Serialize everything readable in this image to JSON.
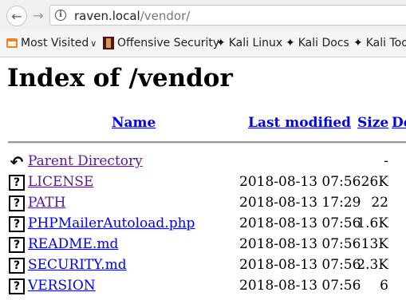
{
  "browser": {
    "url_host": "raven.local",
    "url_path": "/vendor/",
    "bookmarks": [
      {
        "label": "Most Visited",
        "icon": "folder-icon",
        "has_dropdown": true
      },
      {
        "label": "Offensive Security",
        "icon": "offsec-icon"
      },
      {
        "label": "Kali Linux",
        "icon": "kali-dragon-icon"
      },
      {
        "label": "Kali Docs",
        "icon": "kali-dragon-icon"
      },
      {
        "label": "Kali Too",
        "icon": "kali-dragon-icon"
      }
    ]
  },
  "page": {
    "title": "Index of /vendor",
    "columns": {
      "name": "Name",
      "modified": "Last modified",
      "size": "Size",
      "desc": "De"
    },
    "rows": [
      {
        "name": "Parent Directory",
        "modified": "",
        "size": "-",
        "icon": "back-icon"
      },
      {
        "name": "LICENSE",
        "modified": "2018-08-13 07:56",
        "size": "26K",
        "icon": "unknown-file-icon"
      },
      {
        "name": "PATH",
        "modified": "2018-08-13 17:29",
        "size": "22",
        "icon": "unknown-file-icon"
      },
      {
        "name": "PHPMailerAutoload.php",
        "modified": "2018-08-13 07:56",
        "size": "1.6K",
        "icon": "unknown-file-icon"
      },
      {
        "name": "README.md",
        "modified": "2018-08-13 07:56",
        "size": "13K",
        "icon": "unknown-file-icon"
      },
      {
        "name": "SECURITY.md",
        "modified": "2018-08-13 07:56",
        "size": "2.3K",
        "icon": "unknown-file-icon"
      },
      {
        "name": "VERSION",
        "modified": "2018-08-13 07:56",
        "size": "6",
        "icon": "unknown-file-icon"
      }
    ]
  }
}
